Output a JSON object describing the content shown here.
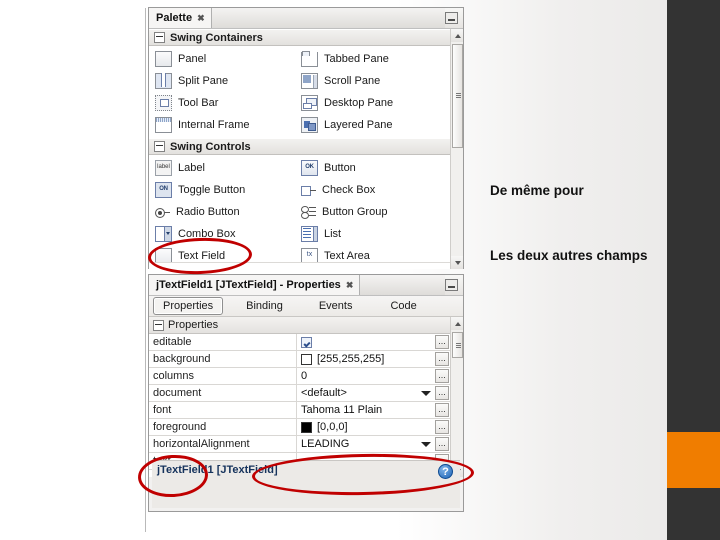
{
  "palette": {
    "title": "Palette",
    "close_glyph": "✖",
    "sections": [
      {
        "name": "Swing Containers",
        "items": [
          {
            "label": "Panel",
            "icon": "panel-icon"
          },
          {
            "label": "Tabbed Pane",
            "icon": "tabbed-pane-icon"
          },
          {
            "label": "Split Pane",
            "icon": "split-pane-icon"
          },
          {
            "label": "Scroll Pane",
            "icon": "scroll-pane-icon"
          },
          {
            "label": "Tool Bar",
            "icon": "tool-bar-icon"
          },
          {
            "label": "Desktop Pane",
            "icon": "desktop-pane-icon"
          },
          {
            "label": "Internal Frame",
            "icon": "internal-frame-icon"
          },
          {
            "label": "Layered Pane",
            "icon": "layered-pane-icon"
          }
        ]
      },
      {
        "name": "Swing Controls",
        "items": [
          {
            "label": "Label",
            "icon": "label-icon",
            "glyph": "label"
          },
          {
            "label": "Button",
            "icon": "button-icon",
            "glyph": "OK"
          },
          {
            "label": "Toggle Button",
            "icon": "toggle-button-icon",
            "glyph": "ON"
          },
          {
            "label": "Check Box",
            "icon": "check-box-icon"
          },
          {
            "label": "Radio Button",
            "icon": "radio-button-icon"
          },
          {
            "label": "Button Group",
            "icon": "button-group-icon"
          },
          {
            "label": "Combo Box",
            "icon": "combo-box-icon"
          },
          {
            "label": "List",
            "icon": "list-icon"
          },
          {
            "label": "Text Field",
            "icon": "text-field-icon"
          },
          {
            "label": "Text Area",
            "icon": "text-area-icon",
            "glyph": "tx"
          }
        ]
      }
    ]
  },
  "properties_window": {
    "title": "jTextField1 [JTextField] - Properties",
    "close_glyph": "✖",
    "tabs": [
      {
        "label": "Properties",
        "selected": true
      },
      {
        "label": "Binding",
        "selected": false
      },
      {
        "label": "Events",
        "selected": false
      },
      {
        "label": "Code",
        "selected": false
      }
    ],
    "section_label": "Properties",
    "rows": [
      {
        "name": "editable",
        "value": "",
        "kind": "checkbox"
      },
      {
        "name": "background",
        "value": "[255,255,255]",
        "kind": "color-white"
      },
      {
        "name": "columns",
        "value": "0",
        "kind": "text"
      },
      {
        "name": "document",
        "value": "<default>",
        "kind": "combo"
      },
      {
        "name": "font",
        "value": "Tahoma 11 Plain",
        "kind": "text"
      },
      {
        "name": "foreground",
        "value": "[0,0,0]",
        "kind": "color-black"
      },
      {
        "name": "horizontalAlignment",
        "value": "LEADING",
        "kind": "combo"
      },
      {
        "name": "text",
        "value": "",
        "kind": "text"
      }
    ],
    "ellipsis_label": "...",
    "status_text": "jTextField1 [JTextField]",
    "help_glyph": "?"
  },
  "annotations": {
    "line1": "De même pour",
    "line2": "Les deux autres champs"
  },
  "colors": {
    "highlight": "#c00000",
    "accent_orange": "#f07d00",
    "dark_band": "#333333"
  }
}
